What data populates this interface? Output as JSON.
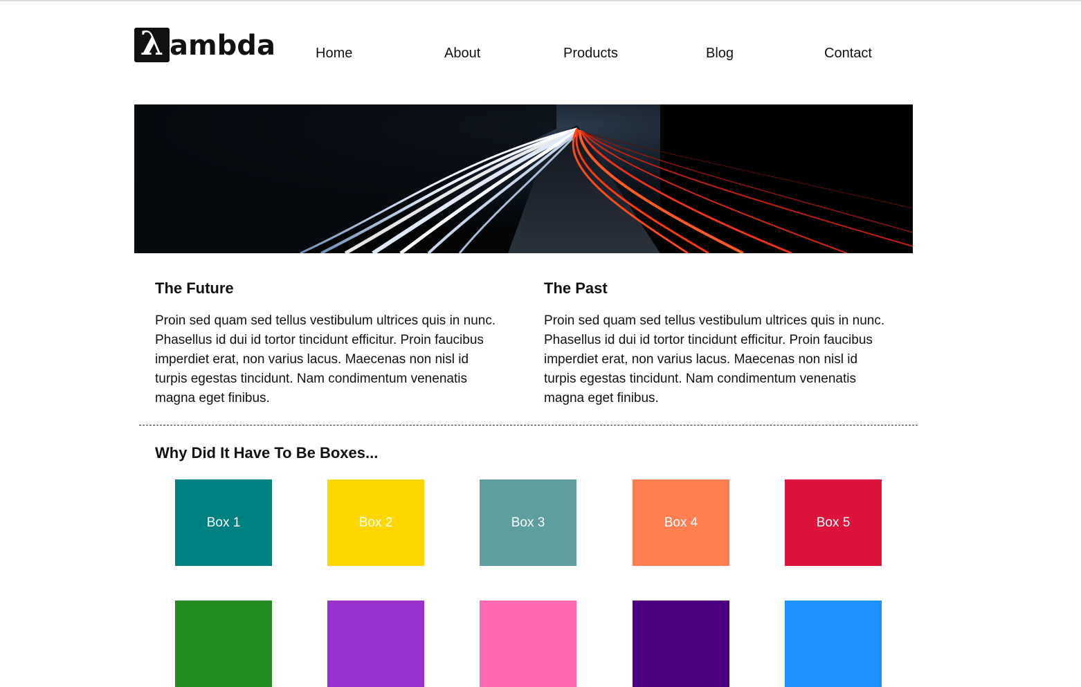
{
  "brand": {
    "logo_symbol": "λ",
    "logo_text": "ambda"
  },
  "nav": {
    "items": [
      "Home",
      "About",
      "Products",
      "Blog",
      "Contact"
    ]
  },
  "columns": [
    {
      "title": "The Future",
      "body": "Proin sed quam sed tellus vestibulum ultrices quis in nunc. Phasellus id dui id tortor tincidunt efficitur. Proin faucibus imperdiet erat, non varius lacus. Maecenas non nisl id turpis egestas tincidunt. Nam condimentum venenatis magna eget finibus."
    },
    {
      "title": "The Past",
      "body": "Proin sed quam sed tellus vestibulum ultrices quis in nunc. Phasellus id dui id tortor tincidunt efficitur. Proin faucibus imperdiet erat, non varius lacus. Maecenas non nisl id turpis egestas tincidunt. Nam condimentum venenatis magna eget finibus."
    }
  ],
  "boxes_section": {
    "title": "Why Did It Have To Be Boxes...",
    "boxes": [
      {
        "label": "Box 1",
        "color": "#008080"
      },
      {
        "label": "Box 2",
        "color": "#FFD700"
      },
      {
        "label": "Box 3",
        "color": "#5F9EA0"
      },
      {
        "label": "Box 4",
        "color": "#FF7F50"
      },
      {
        "label": "Box 5",
        "color": "#DC143C"
      },
      {
        "label": "",
        "color": "#228B22"
      },
      {
        "label": "",
        "color": "#9932CC"
      },
      {
        "label": "",
        "color": "#FF69B4"
      },
      {
        "label": "",
        "color": "#4B0082"
      },
      {
        "label": "",
        "color": "#1E90FF"
      }
    ]
  }
}
